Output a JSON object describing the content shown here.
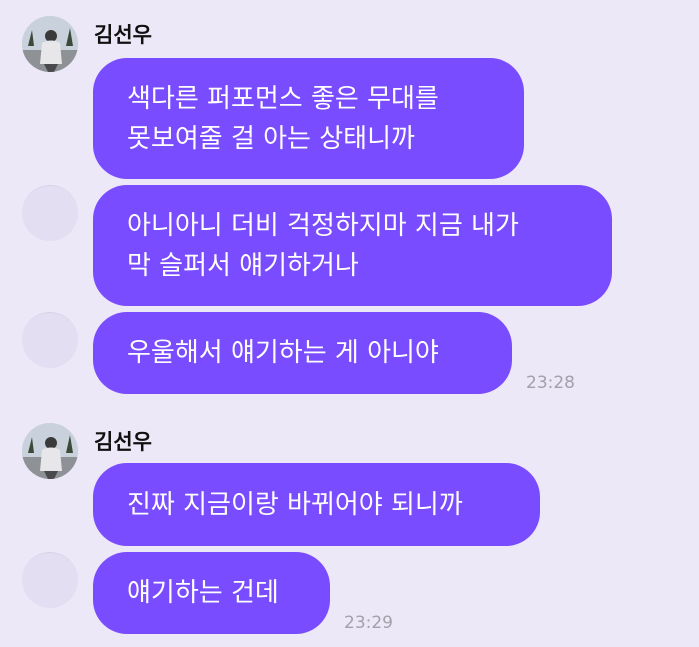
{
  "chat": {
    "group1": {
      "sender": "김선우",
      "messages": [
        {
          "lines": [
            "색다른 퍼포먼스 좋은 무대를",
            "못보여줄 걸 아는 상태니까"
          ]
        },
        {
          "lines": [
            "아니아니 더비 걱정하지마 지금 내가",
            "막 슬퍼서 얘기하거나"
          ]
        },
        {
          "lines": [
            "우울해서 얘기하는 게 아니야"
          ]
        }
      ],
      "time": "23:28"
    },
    "group2": {
      "sender": "김선우",
      "messages": [
        {
          "lines": [
            "진짜 지금이랑 바뀌어야 되니까"
          ]
        },
        {
          "lines": [
            "얘기하는 건데"
          ]
        }
      ],
      "time": "23:29"
    }
  },
  "colors": {
    "background": "#ece8f8",
    "bubble": "#7a4cff",
    "bubble_text": "#ffffff",
    "time": "#a3a0aa"
  },
  "icons": {
    "avatar": "profile-photo-avatar"
  }
}
